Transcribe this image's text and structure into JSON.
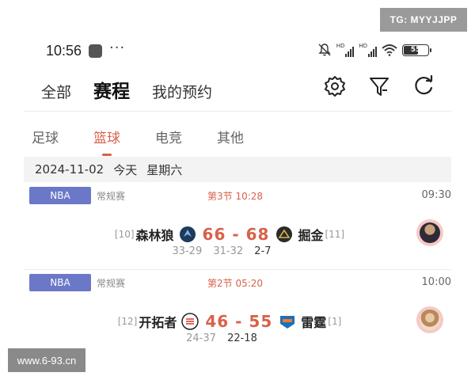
{
  "watermarks": {
    "tg": "TG: MYYJJPP",
    "site": "www.6-93.cn"
  },
  "status_bar": {
    "time": "10:56",
    "dots": "···",
    "hd1": "HD",
    "hd2": "HD",
    "battery": "55"
  },
  "top_tabs": [
    {
      "label": "全部"
    },
    {
      "label": "赛程",
      "active": true
    },
    {
      "label": "我的预约"
    }
  ],
  "toolbar": {
    "icons": [
      "gear-icon",
      "filter-icon",
      "refresh-icon"
    ]
  },
  "sport_tabs": [
    {
      "label": "足球"
    },
    {
      "label": "篮球",
      "active": true
    },
    {
      "label": "电竞"
    },
    {
      "label": "其他"
    }
  ],
  "date_bar": {
    "date": "2024-11-02",
    "relative": "今天",
    "weekday": "星期六"
  },
  "colors": {
    "accent": "#d9614a",
    "league_badge": "#6b78c8",
    "avatar_ring": "#f6c9c6"
  },
  "matches": [
    {
      "league": "NBA",
      "type": "常规赛",
      "period": "第3节 10:28",
      "start_time": "09:30",
      "home": {
        "rank": "[10]",
        "name": "森林狼",
        "logo": "timberwolves-logo"
      },
      "away": {
        "rank": "[11]",
        "name": "掘金",
        "logo": "nuggets-logo"
      },
      "score": "66 - 68",
      "quarters": [
        "33-29",
        "31-32",
        "2-7"
      ]
    },
    {
      "league": "NBA",
      "type": "常规赛",
      "period": "第2节 05:20",
      "start_time": "10:00",
      "home": {
        "rank": "[12]",
        "name": "开拓者",
        "logo": "trailblazers-logo"
      },
      "away": {
        "rank": "[1]",
        "name": "雷霆",
        "logo": "thunder-logo"
      },
      "score": "46 - 55",
      "quarters": [
        "24-37",
        "22-18"
      ]
    }
  ]
}
